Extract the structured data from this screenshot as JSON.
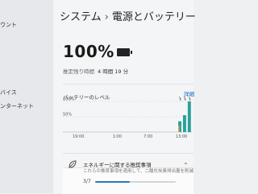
{
  "window": {
    "breadcrumb_parent": "システム",
    "breadcrumb_sep": "›",
    "breadcrumb_current": "電源とバッテリー"
  },
  "sidebar": {
    "items": [
      {
        "label": "ウント"
      },
      {
        "label": "バイス"
      },
      {
        "label": "ンターネット"
      }
    ]
  },
  "battery": {
    "percent_text": "100%",
    "estimate_label": "推定残り時間",
    "estimate_value": "4 時間 19 分",
    "icon": "battery-full-icon",
    "level": 1.0
  },
  "level_section": {
    "label": "バッテリーのレベル",
    "details_link": "詳細"
  },
  "chart_data": {
    "type": "bar",
    "ytick_labels": [
      "100%",
      "50%"
    ],
    "xtick_labels": [
      "19:00",
      "1:00",
      "7:00",
      "13:00"
    ],
    "values": [
      0,
      0,
      0,
      0,
      0,
      0,
      0,
      0,
      0,
      0,
      0,
      0,
      0,
      0,
      0,
      0,
      0,
      0,
      0,
      0,
      0,
      35,
      55,
      100
    ],
    "charging_markers": 3,
    "ylim": [
      0,
      100
    ],
    "colors": {
      "bar": "#2aa198",
      "accent": "#e8a54b",
      "grid": "#cfd3d6"
    }
  },
  "tip": {
    "title": "エネルギーに関する推奨事項",
    "description": "これらの推奨事項を適用して、二酸化炭素排出量を削減",
    "progress_text": "3/7",
    "progress": 0.43,
    "icon": "leaf-icon"
  }
}
